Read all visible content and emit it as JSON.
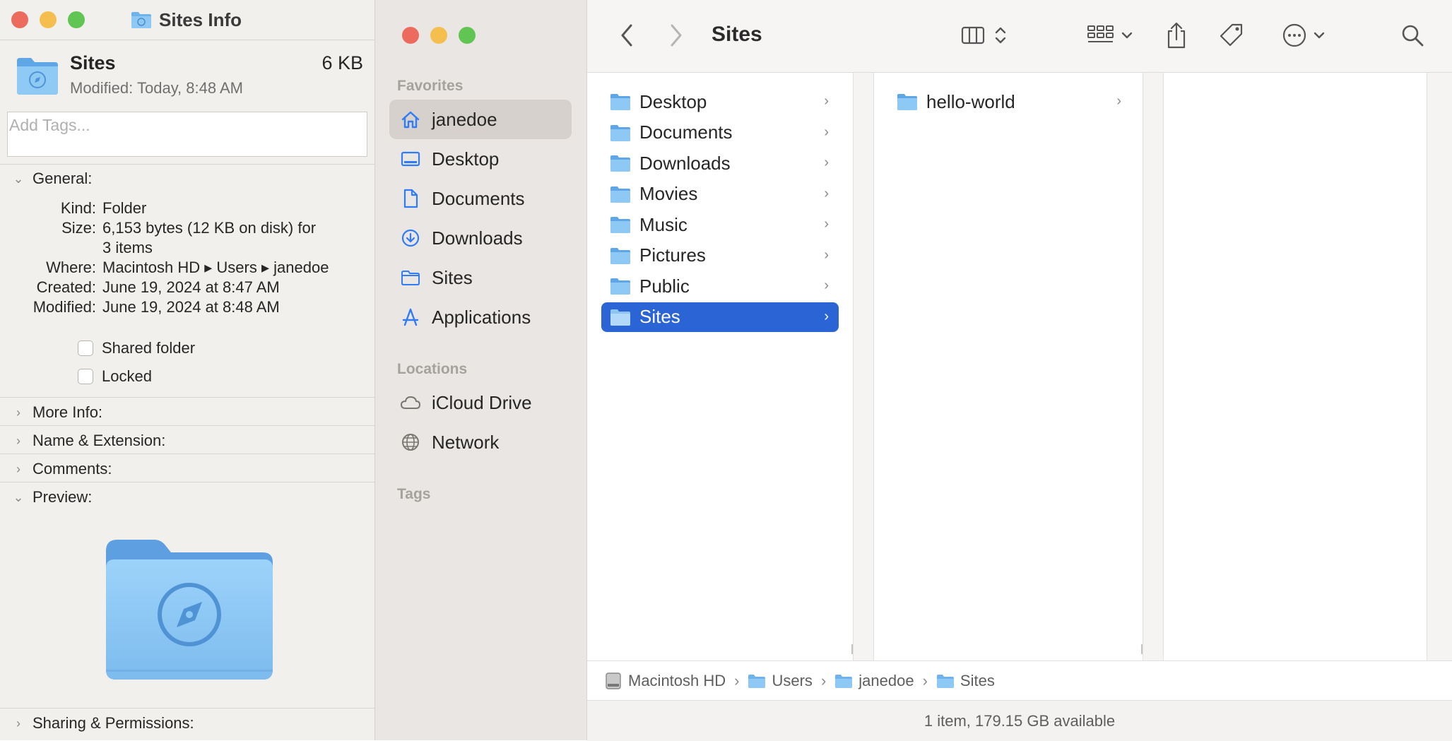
{
  "info": {
    "window_title": "Sites Info",
    "summary": {
      "name": "Sites",
      "size": "6 KB",
      "modified": "Modified: Today, 8:48 AM"
    },
    "tags_placeholder": "Add Tags...",
    "general": {
      "header": "General:",
      "kind_label": "Kind:",
      "kind_value": "Folder",
      "size_label": "Size:",
      "size_value_line1": "6,153 bytes (12 KB on disk) for",
      "size_value_line2": "3 items",
      "where_label": "Where:",
      "where_value": "Macintosh HD ▸ Users ▸ janedoe",
      "created_label": "Created:",
      "created_value": "June 19, 2024 at 8:47 AM",
      "modified_label": "Modified:",
      "modified_value": "June 19, 2024 at 8:48 AM"
    },
    "checkboxes": {
      "shared": "Shared folder",
      "locked": "Locked"
    },
    "sections": {
      "more_info": "More Info:",
      "name_ext": "Name & Extension:",
      "comments": "Comments:",
      "preview": "Preview:",
      "sharing": "Sharing & Permissions:"
    }
  },
  "sidebar": {
    "favorites_header": "Favorites",
    "favorites": [
      {
        "label": "janedoe",
        "icon": "house-icon"
      },
      {
        "label": "Desktop",
        "icon": "desktop-icon"
      },
      {
        "label": "Documents",
        "icon": "document-icon"
      },
      {
        "label": "Downloads",
        "icon": "download-icon"
      },
      {
        "label": "Sites",
        "icon": "folder-icon"
      },
      {
        "label": "Applications",
        "icon": "applications-icon"
      }
    ],
    "locations_header": "Locations",
    "locations": [
      {
        "label": "iCloud Drive",
        "icon": "cloud-icon"
      },
      {
        "label": "Network",
        "icon": "globe-icon"
      }
    ],
    "tags_header": "Tags"
  },
  "toolbar": {
    "title": "Sites"
  },
  "columns": {
    "col1": [
      "Desktop",
      "Documents",
      "Downloads",
      "Movies",
      "Music",
      "Pictures",
      "Public",
      "Sites"
    ],
    "col1_selected": "Sites",
    "col2": [
      "hello-world"
    ]
  },
  "pathbar": [
    "Macintosh HD",
    "Users",
    "janedoe",
    "Sites"
  ],
  "status": "1 item, 179.15 GB available",
  "colors": {
    "selection": "#2b64d4",
    "folder": "#6fb3ec",
    "accent": "#2f7cf6"
  }
}
